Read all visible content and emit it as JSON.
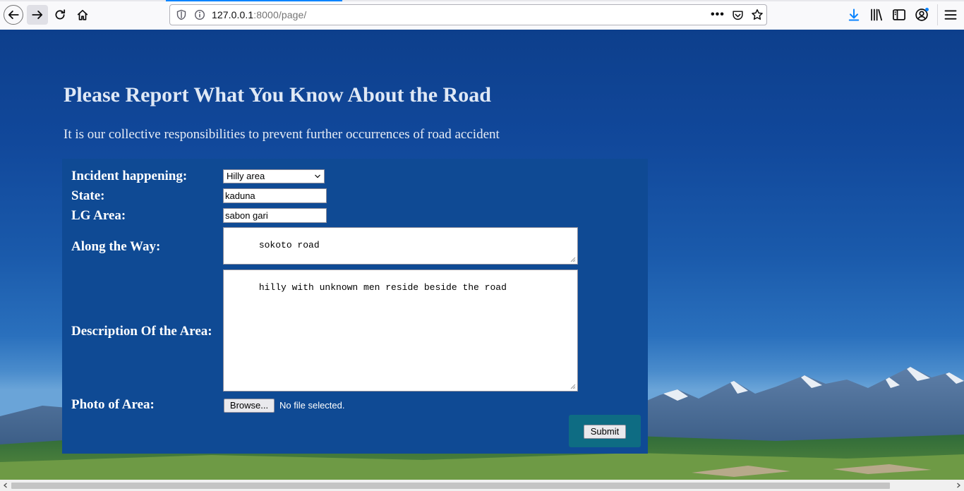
{
  "browser": {
    "url_host": "127.0.0.1",
    "url_rest": ":8000/page/",
    "more_label": "•••"
  },
  "page": {
    "title": "Please Report What You Know About the Road",
    "subtitle": "It is our collective responsibilities to prevent further occurrences of road accident"
  },
  "form": {
    "incident_label": "Incident happening:",
    "incident_value": "Hilly area",
    "state_label": "State:",
    "state_value": "kaduna",
    "lg_label": "LG Area:",
    "lg_value": "sabon gari",
    "along_label": "Along the Way:",
    "along_value": "sokoto road",
    "desc_label": "Description Of the Area:",
    "desc_value": "hilly with unknown men reside beside the road",
    "photo_label": "Photo of Area:",
    "browse_label": "Browse...",
    "no_file_text": "No file selected.",
    "submit_label": "Submit"
  },
  "colors": {
    "accent": "#0a84ff",
    "panel": "#0f4a94",
    "submit_bg": "#0e6c83"
  },
  "icons": [
    "back-arrow-icon",
    "forward-arrow-icon",
    "reload-icon",
    "home-icon",
    "shield-icon",
    "info-icon",
    "pocket-icon",
    "star-icon",
    "download-icon",
    "library-icon",
    "sidebar-icon",
    "account-icon",
    "menu-icon"
  ]
}
